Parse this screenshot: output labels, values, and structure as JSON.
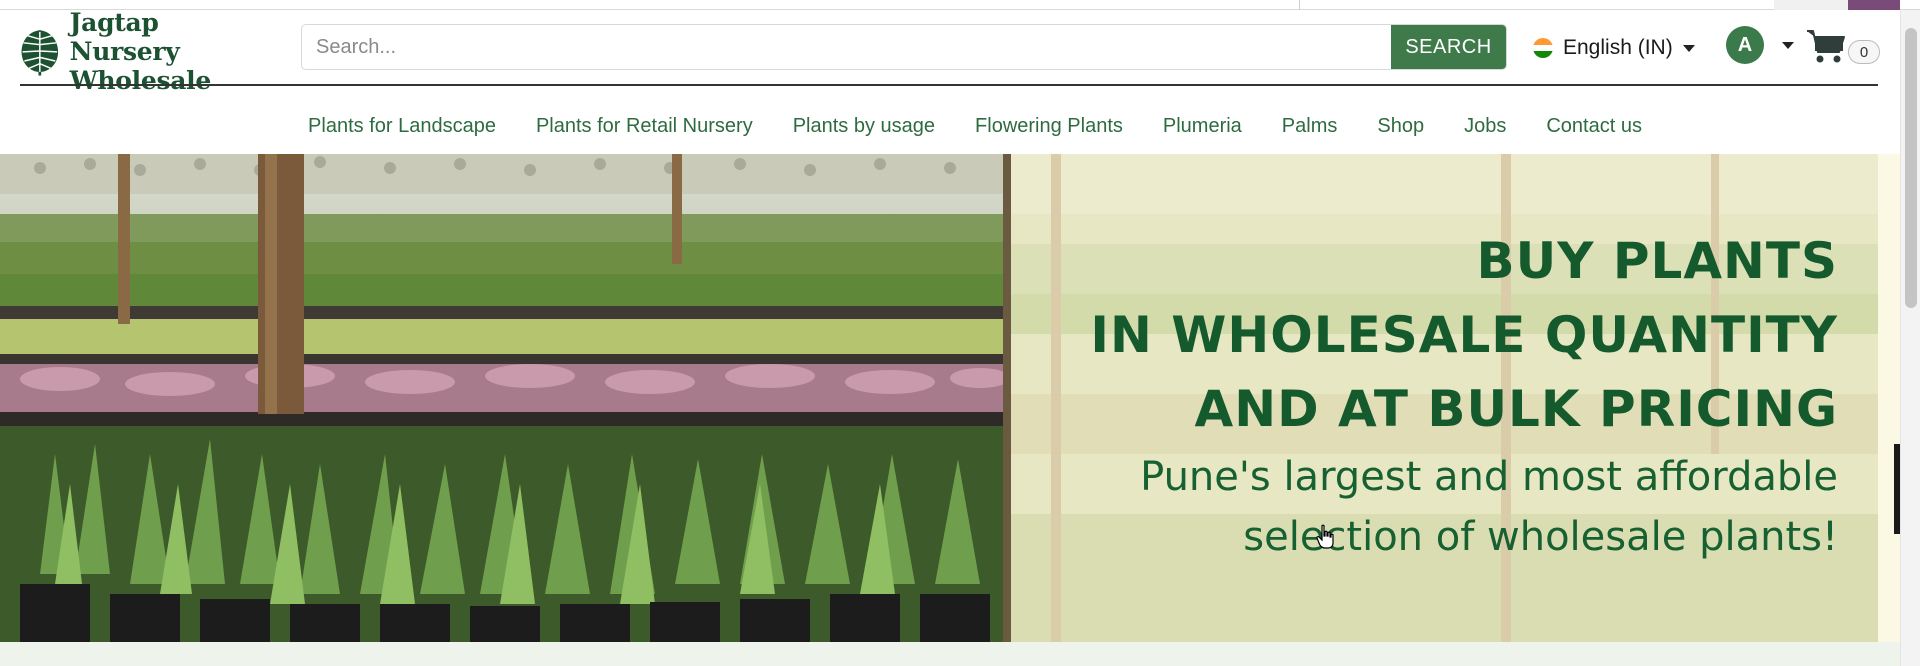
{
  "brand": {
    "name_line1": "Jagtap Nursery",
    "name_line2": "Wholesale",
    "logo_icon": "monstera-leaf-icon",
    "primary_color": "#1c5232"
  },
  "search": {
    "placeholder": "Search...",
    "button_label": "SEARCH",
    "button_color": "#3e7a4a"
  },
  "language": {
    "label": "English (IN)",
    "flag_icon": "india-flag-icon"
  },
  "account": {
    "avatar_initial": "A"
  },
  "cart": {
    "icon": "shopping-cart-icon",
    "count": "0"
  },
  "nav": {
    "items": [
      {
        "label": "Plants for Landscape"
      },
      {
        "label": "Plants for Retail Nursery"
      },
      {
        "label": "Plants by usage"
      },
      {
        "label": "Flowering Plants"
      },
      {
        "label": "Plumeria"
      },
      {
        "label": "Palms"
      },
      {
        "label": "Shop"
      },
      {
        "label": "Jobs"
      },
      {
        "label": "Contact us"
      }
    ]
  },
  "hero": {
    "heading_line1": "BUY PLANTS",
    "heading_line2": "IN WHOLESALE QUANTITY",
    "heading_line3": "AND AT BULK PRICING",
    "sub_line1": "Pune's largest and most affordable",
    "sub_line2": "selection of wholesale plants!",
    "text_color": "#155a2d"
  }
}
